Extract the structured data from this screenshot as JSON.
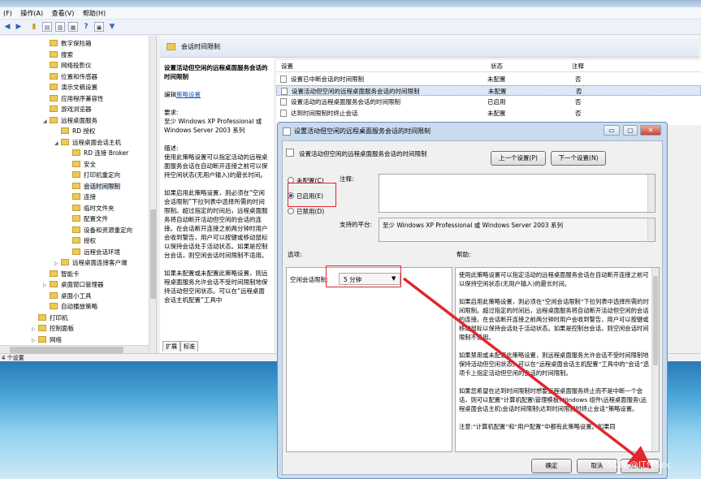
{
  "menubar": [
    "(F)",
    "操作(A)",
    "查看(V)",
    "帮助(H)"
  ],
  "tree": [
    {
      "label": "数字保险箱",
      "x": 65,
      "tog": ""
    },
    {
      "label": "搜索",
      "x": 65,
      "tog": ""
    },
    {
      "label": "网络投影仪",
      "x": 65,
      "tog": ""
    },
    {
      "label": "位置和传感器",
      "x": 65,
      "tog": ""
    },
    {
      "label": "演示文稿设置",
      "x": 65,
      "tog": ""
    },
    {
      "label": "应用程序兼容性",
      "x": 65,
      "tog": ""
    },
    {
      "label": "游戏浏览器",
      "x": 65,
      "tog": ""
    },
    {
      "label": "远程桌面服务",
      "x": 65,
      "tog": "◢"
    },
    {
      "label": "RD 授权",
      "x": 79,
      "tog": ""
    },
    {
      "label": "远程桌面会话主机",
      "x": 79,
      "tog": "◢"
    },
    {
      "label": "RD 连接 Broker",
      "x": 93,
      "tog": ""
    },
    {
      "label": "安全",
      "x": 93,
      "tog": ""
    },
    {
      "label": "打印机重定向",
      "x": 93,
      "tog": ""
    },
    {
      "label": "会话时间限制",
      "x": 93,
      "tog": "",
      "sel": true
    },
    {
      "label": "连接",
      "x": 93,
      "tog": ""
    },
    {
      "label": "临时文件夹",
      "x": 93,
      "tog": ""
    },
    {
      "label": "配置文件",
      "x": 93,
      "tog": ""
    },
    {
      "label": "设备和资源重定向",
      "x": 93,
      "tog": ""
    },
    {
      "label": "授权",
      "x": 93,
      "tog": ""
    },
    {
      "label": "远程会话环境",
      "x": 93,
      "tog": ""
    },
    {
      "label": "远程桌面连接客户端",
      "x": 79,
      "tog": "▷"
    },
    {
      "label": "智能卡",
      "x": 65,
      "tog": ""
    },
    {
      "label": "桌面窗口管理器",
      "x": 65,
      "tog": "▷"
    },
    {
      "label": "桌面小工具",
      "x": 65,
      "tog": ""
    },
    {
      "label": "自动播放策略",
      "x": 65,
      "tog": ""
    },
    {
      "label": "打印机",
      "x": 51,
      "tog": ""
    },
    {
      "label": "控制面板",
      "x": 51,
      "tog": "▷"
    },
    {
      "label": "网络",
      "x": 51,
      "tog": "▷"
    },
    {
      "label": "系统",
      "x": 51,
      "tog": "▷"
    }
  ],
  "status": "4 个设置",
  "breadcrumb": "会话时间限制",
  "desc": {
    "title": "设置活动但空闲的远程桌面服务会话的时间限制",
    "edit_prefix": "编辑",
    "edit_link": "策略设置",
    "req_label": "要求:",
    "req_text": "至少 Windows XP Professional 或 Windows Server 2003 系列",
    "desc_label": "描述:",
    "p1": "使用此策略设置可以指定活动的远程桌面服务会话在自动断开连接之前可以保持空闲状态(无用户输入)的最长时间。",
    "p2": "如果启用此策略设置，则必须在“空闲会话限制”下拉列表中选择所需的时间限制。超过指定的时间后，远程桌面服务将自动断开活动但空闲的会话的连接。在会话断开连接之前两分钟时用户会收到警告，用户可以按键或移动鼠标以保持会话处于活动状态。如果是控制台会话，则空闲会话时间限制不适用。",
    "p3": "如果未配置或未配置此策略设置，则远程桌面服务允许会话不受时间限制地保持活动但空闲状态。可以在“远程桌面会话主机配置”工具中"
  },
  "ext_tabs": [
    "扩展",
    "标准"
  ],
  "list": {
    "headers": {
      "setting": "设置",
      "state": "状态",
      "comment": "注释"
    },
    "rows": [
      {
        "setting": "设置已中断会话的时间限制",
        "state": "未配置",
        "comment": "否"
      },
      {
        "setting": "设置活动但空闲的远程桌面服务会话的时间限制",
        "state": "未配置",
        "comment": "否",
        "sel": true
      },
      {
        "setting": "设置活动的远程桌面服务会话的时间限制",
        "state": "已启用",
        "comment": "否"
      },
      {
        "setting": "达到时间限制时终止会话",
        "state": "未配置",
        "comment": "否"
      }
    ]
  },
  "dialog": {
    "title": "设置活动但空闲的远程桌面服务会话的时间限制",
    "inner_title": "设置活动但空闲的远程桌面服务会话的时间限制",
    "prev": "上一个设置(P)",
    "next": "下一个设置(N)",
    "radios": {
      "not_configured": "未配置(C)",
      "enabled": "已启用(E)",
      "disabled": "已禁用(D)"
    },
    "comment_label": "注释:",
    "platform_label": "支持的平台:",
    "platform_value": "至少 Windows XP Professional 或 Windows Server 2003 系列",
    "options_label": "选项:",
    "help_label": "帮助:",
    "idle_label": "空闲会话限制:",
    "idle_value": "5 分钟",
    "help": {
      "p1": "使用此策略设置可以指定活动的远程桌面服务会话在自动断开连接之前可以保持空闲状态(无用户输入)的最长时间。",
      "p2": "如果启用此策略设置，则必须在“空闲会话限制”下拉列表中选择所需的时间限制。超过指定的时间后，远程桌面服务将自动断开活动但空闲的会话的连接。在会话断开连接之前两分钟时用户会收到警告，用户可以按键或移动鼠标以保持会话处于活动状态。如果是控制台会话，则空闲会话时间限制不适用。",
      "p3": "如果禁用或未配置此策略设置，则远程桌面服务允许会话不受时间限制地保持活动但空闲状态。可以在“远程桌面会话主机配置”工具中的“会话”选项卡上指定活动但空闲的会话的时间限制。",
      "p4": "如果您希望在达到时间限制时想要远程桌面服务终止而不是中断一个会话，则可以配置“计算机配置\\管理模板\\Windows 组件\\远程桌面服务\\远程桌面会话主机\\会话时间限制\\达到时间限制时终止会话”策略设置。",
      "p5": "注意:“计算机配置”和“用户配置”中都有此策略设置。如果同"
    },
    "ok": "确定",
    "cancel": "取消",
    "apply": "应用(A)"
  },
  "watermark": "CSDN @IT仔Sec",
  "colors": {
    "highlight": "#e0262e",
    "accent": "#1b4fa6"
  }
}
